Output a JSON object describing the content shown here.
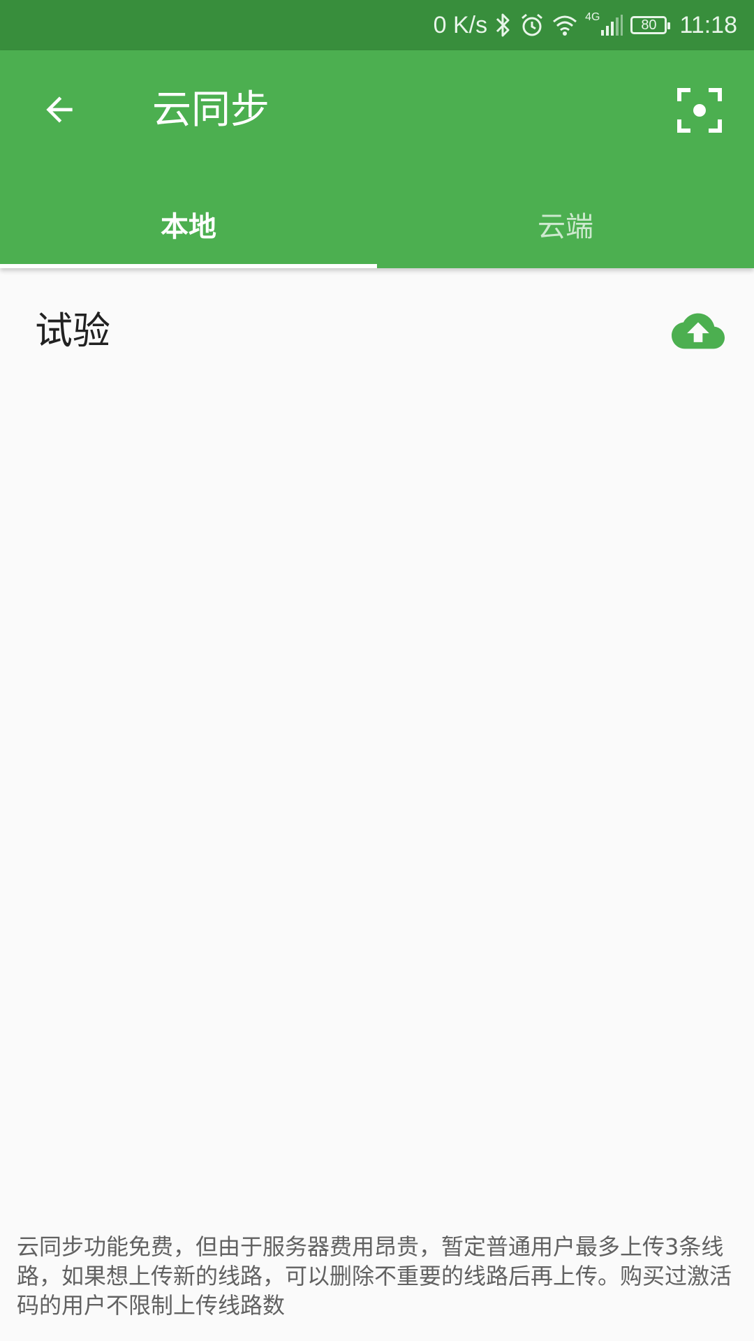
{
  "status_bar": {
    "net_speed": "0 K/s",
    "network_type": "4G",
    "battery": "80",
    "time": "11:18",
    "icons": [
      "bluetooth-icon",
      "alarm-icon",
      "wifi-icon",
      "signal-icon",
      "battery-icon"
    ]
  },
  "app_bar": {
    "title": "云同步",
    "back_icon": "arrow-left-icon",
    "action_icon": "scan-icon",
    "color": "#4caf50",
    "status_color": "#388e3c"
  },
  "tabs": [
    {
      "label": "本地",
      "active": true
    },
    {
      "label": "云端",
      "active": false
    }
  ],
  "routes": [
    {
      "name": "试验",
      "action_icon": "cloud-upload-icon"
    }
  ],
  "footer": {
    "note": "云同步功能免费，但由于服务器费用昂贵，暂定普通用户最多上传3条线路，如果想上传新的线路，可以删除不重要的线路后再上传。购买过激活码的用户不限制上传线路数"
  },
  "accent_color": "#4caf50"
}
